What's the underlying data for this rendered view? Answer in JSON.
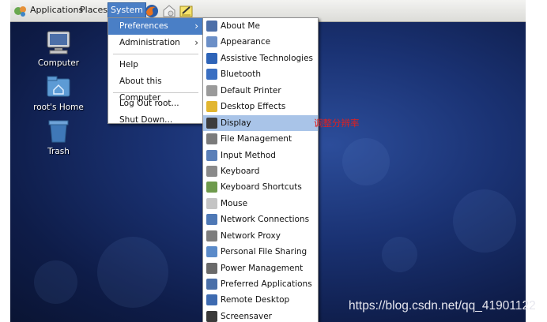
{
  "panel": {
    "applications": "Applications",
    "places": "Places",
    "system": "System"
  },
  "desktop": {
    "icons": [
      {
        "label": "Computer"
      },
      {
        "label": "root's Home"
      },
      {
        "label": "Trash"
      }
    ]
  },
  "system_menu": {
    "items": [
      {
        "label": "Preferences"
      },
      {
        "label": "Administration"
      },
      {
        "label": "Help"
      },
      {
        "label": "About this Computer"
      },
      {
        "label": "Log Out root..."
      },
      {
        "label": "Shut Down..."
      }
    ]
  },
  "preferences_menu": {
    "items": [
      {
        "label": "About Me",
        "icon": "about-me-icon",
        "color": "#4d6fa8"
      },
      {
        "label": "Appearance",
        "icon": "appearance-icon",
        "color": "#6b8fc7"
      },
      {
        "label": "Assistive Technologies",
        "icon": "accessibility-icon",
        "color": "#2e64b8"
      },
      {
        "label": "Bluetooth",
        "icon": "bluetooth-icon",
        "color": "#3a6fc2"
      },
      {
        "label": "Default Printer",
        "icon": "printer-icon",
        "color": "#9a9a9a"
      },
      {
        "label": "Desktop Effects",
        "icon": "desktop-effects-icon",
        "color": "#e2b630"
      },
      {
        "label": "Display",
        "icon": "display-icon",
        "color": "#3d3d3d"
      },
      {
        "label": "File Management",
        "icon": "file-management-icon",
        "color": "#7b7b7b"
      },
      {
        "label": "Input Method",
        "icon": "input-method-icon",
        "color": "#5a7fb8"
      },
      {
        "label": "Keyboard",
        "icon": "keyboard-icon",
        "color": "#8a8a8a"
      },
      {
        "label": "Keyboard Shortcuts",
        "icon": "keyboard-shortcuts-icon",
        "color": "#6e9a4c"
      },
      {
        "label": "Mouse",
        "icon": "mouse-icon",
        "color": "#c4c4c4"
      },
      {
        "label": "Network Connections",
        "icon": "network-connections-icon",
        "color": "#4e78b5"
      },
      {
        "label": "Network Proxy",
        "icon": "network-proxy-icon",
        "color": "#7d7d7d"
      },
      {
        "label": "Personal File Sharing",
        "icon": "file-sharing-icon",
        "color": "#5a8ac9"
      },
      {
        "label": "Power Management",
        "icon": "power-management-icon",
        "color": "#6a6a6a"
      },
      {
        "label": "Preferred Applications",
        "icon": "preferred-applications-icon",
        "color": "#4a6fa8"
      },
      {
        "label": "Remote Desktop",
        "icon": "remote-desktop-icon",
        "color": "#3d6ab0"
      },
      {
        "label": "Screensaver",
        "icon": "screensaver-icon",
        "color": "#3a3a3a"
      }
    ]
  },
  "annotation": "调整分辨率",
  "watermark": "https://blog.csdn.net/qq_41901122",
  "colors": {
    "menu_highlight": "#4a7fc6",
    "hover_highlight": "#a9c4e8",
    "annotation": "#e02020"
  }
}
